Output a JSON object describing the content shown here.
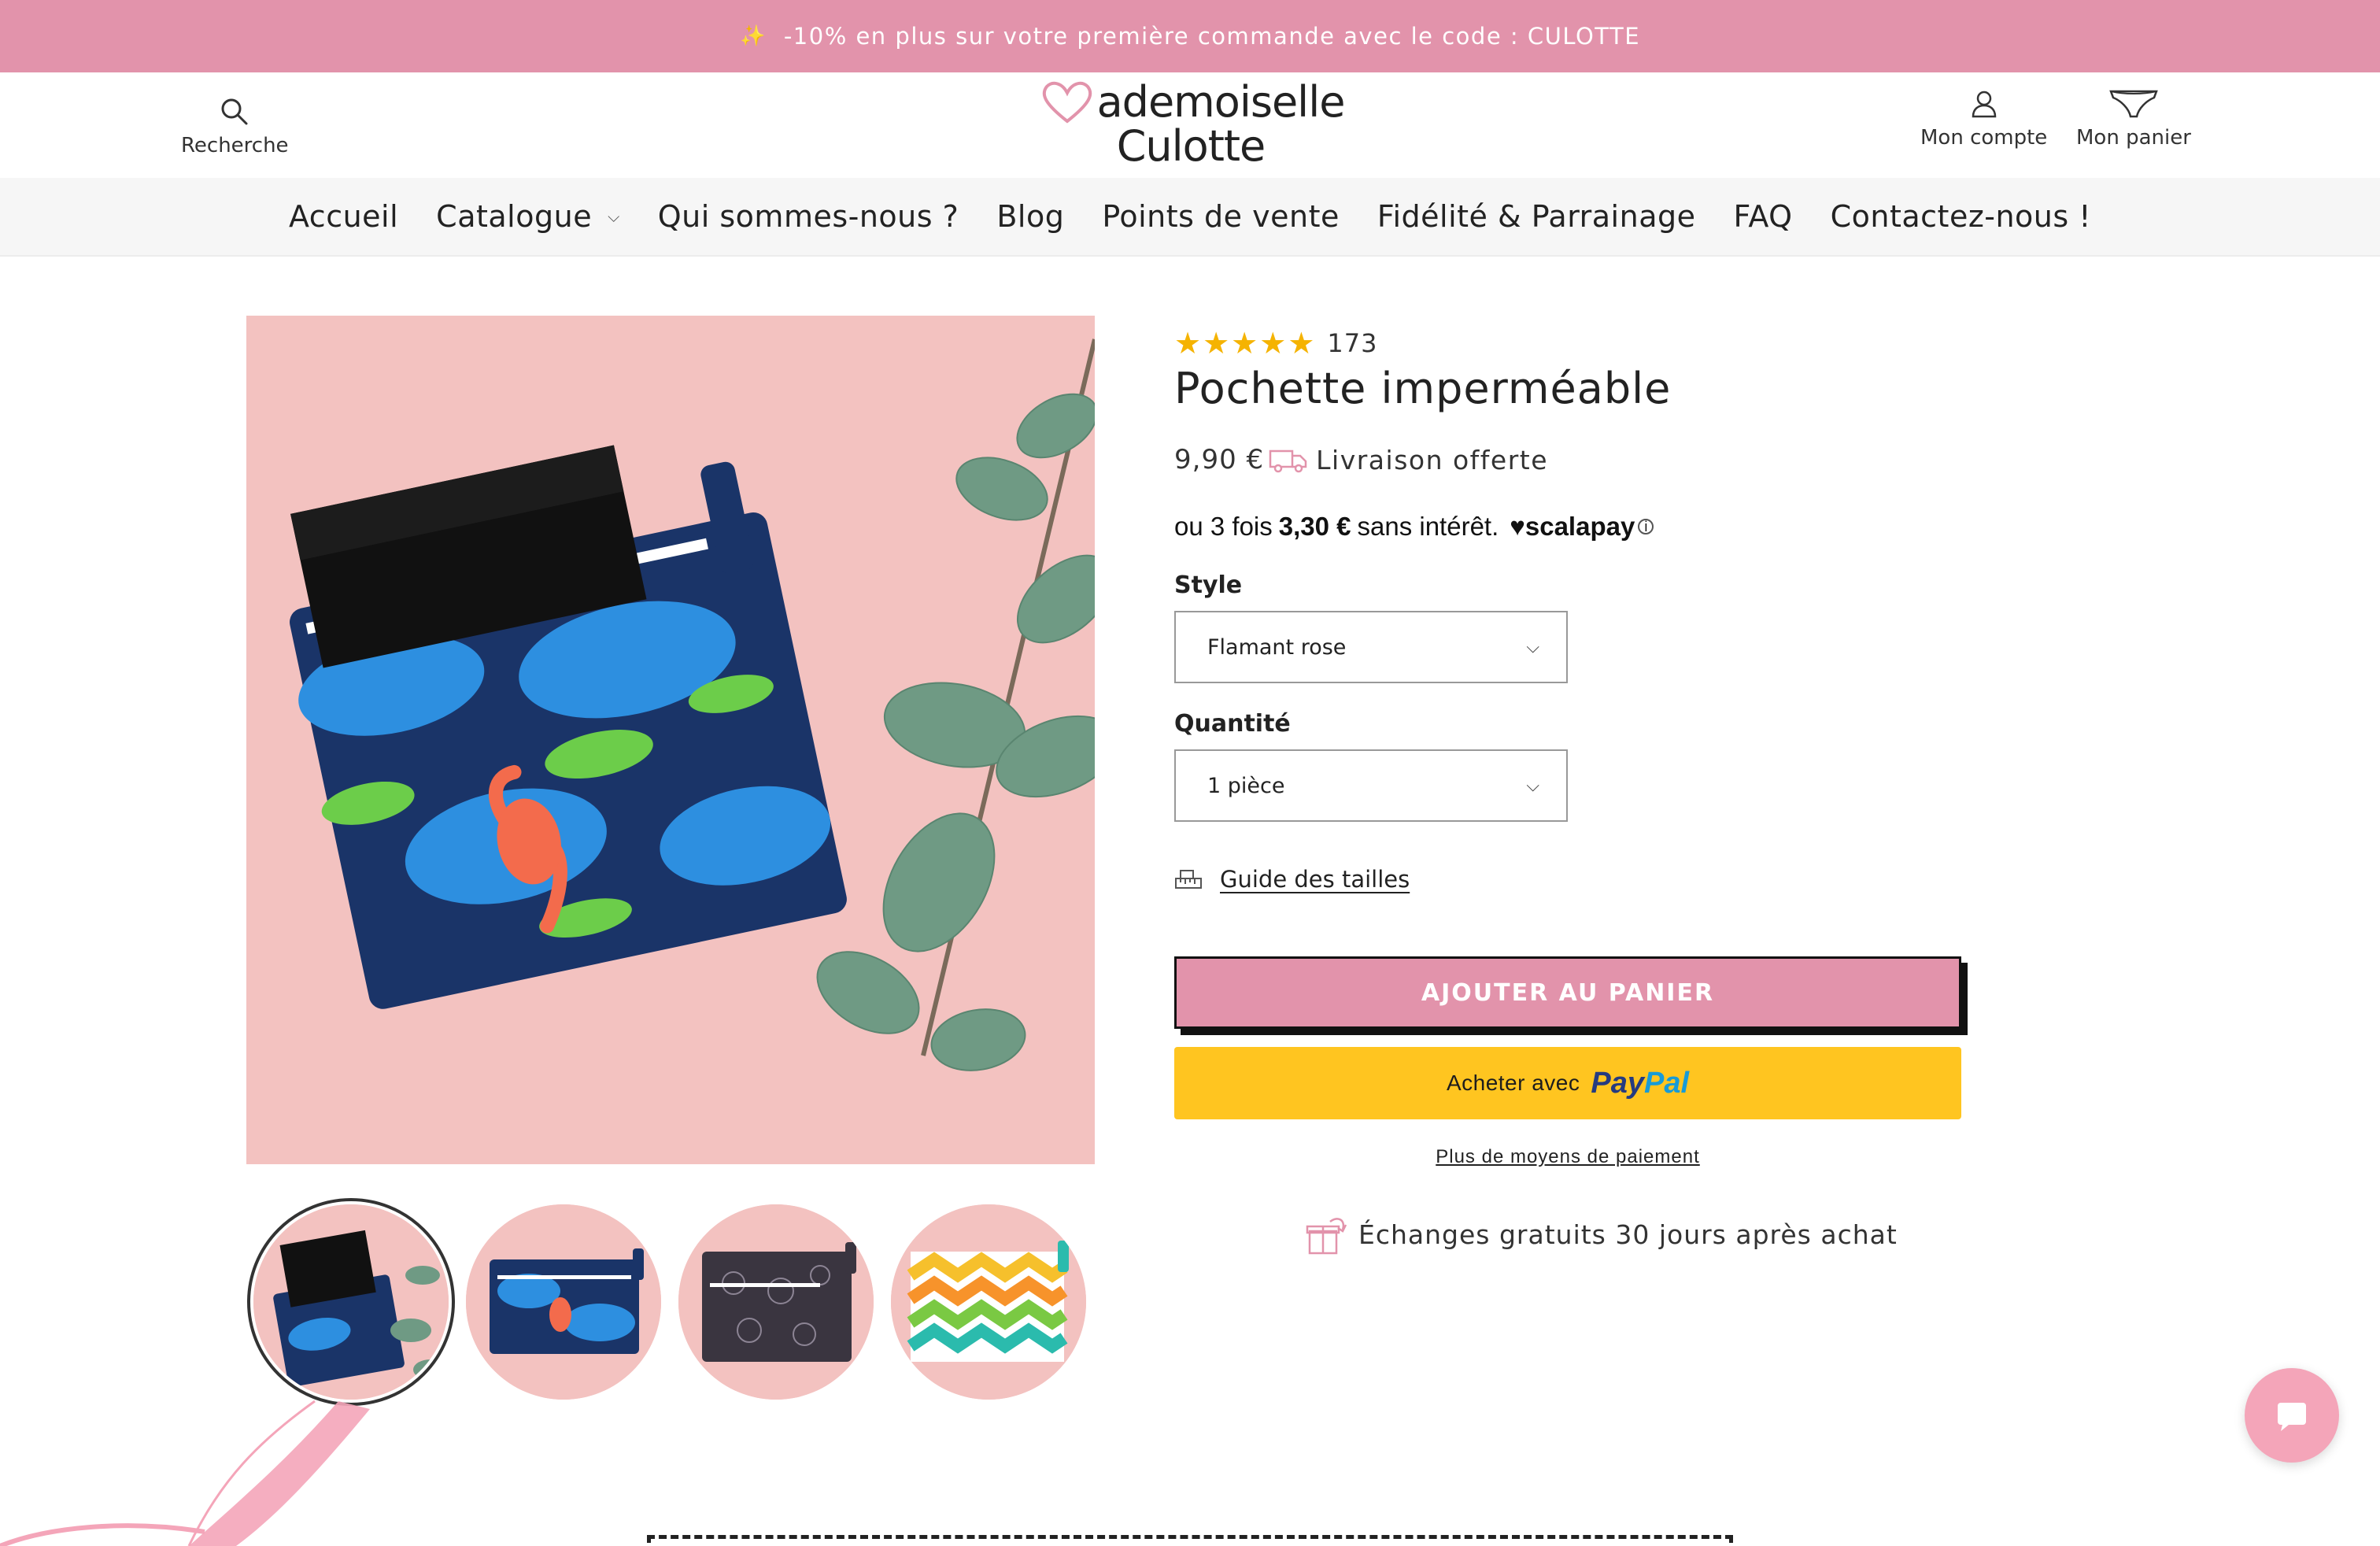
{
  "announcement": {
    "icon": "sparkles-icon",
    "text": "-10% en plus sur votre première commande avec le code : CULOTTE"
  },
  "header": {
    "search_label": "Recherche",
    "account_label": "Mon compte",
    "cart_label": "Mon panier",
    "logo_line1": "ademoiselle",
    "logo_line2": "Culotte"
  },
  "nav": [
    "Accueil",
    "Catalogue",
    "Qui sommes-nous ?",
    "Blog",
    "Points de vente",
    "Fidélité & Parrainage",
    "FAQ",
    "Contactez-nous !"
  ],
  "product": {
    "rating": 5,
    "review_count": "173",
    "title": "Pochette imperméable",
    "price": "9,90 €",
    "shipping": "Livraison offerte",
    "installments_prefix": "ou 3 fois",
    "installments_amount": "3,30 €",
    "installments_suffix": "sans intérêt.",
    "installments_brand": "scalapay",
    "style_label": "Style",
    "style_value": "Flamant rose",
    "quantity_label": "Quantité",
    "quantity_value": "1 pièce",
    "size_guide": "Guide des tailles",
    "add_to_cart": "AJOUTER AU PANIER",
    "paypal_prefix": "Acheter avec",
    "paypal_brand_1": "Pay",
    "paypal_brand_2": "Pal",
    "more_payment": "Plus de moyens de paiement",
    "exchange": "Échanges gratuits 30 jours après achat"
  },
  "colors": {
    "brand_pink": "#e293ab",
    "paypal_yellow": "#ffc520",
    "star": "#f5b301",
    "image_bg": "#f3c2c0"
  },
  "thumbnails": [
    "flamant-rose-with-underwear",
    "flamant-rose",
    "dentelle-noire",
    "chevrons-multicolores"
  ]
}
